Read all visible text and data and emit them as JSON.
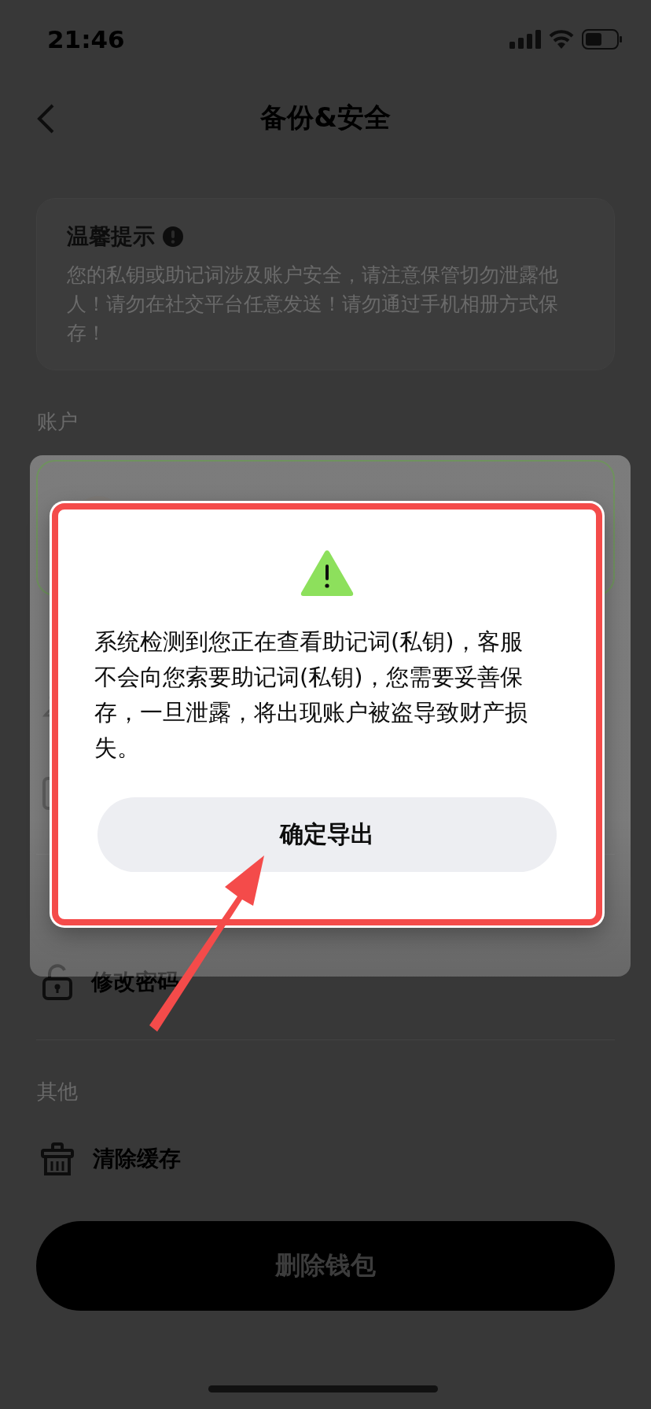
{
  "status_bar": {
    "time": "21:46"
  },
  "nav": {
    "title": "备份&安全"
  },
  "tip": {
    "title": "温馨提示",
    "body": "您的私钥或助记词涉及账户安全，请注意保管切勿泄露他人！请勿在社交平台任意发送！请勿通过手机相册方式保存！"
  },
  "account_section": {
    "label": "账户"
  },
  "security_section": {
    "item": "修改密码"
  },
  "other_section": {
    "label": "其他",
    "item": "清除缓存"
  },
  "delete_button": "删除钱包",
  "dialog": {
    "message": "系统检测到您正在查看助记词(私钥)，客服不会向您索要助记词(私钥)，您需要妥善保存，一旦泄露，将出现账户被盗导致财产损失。",
    "confirm_button": "确定导出"
  }
}
